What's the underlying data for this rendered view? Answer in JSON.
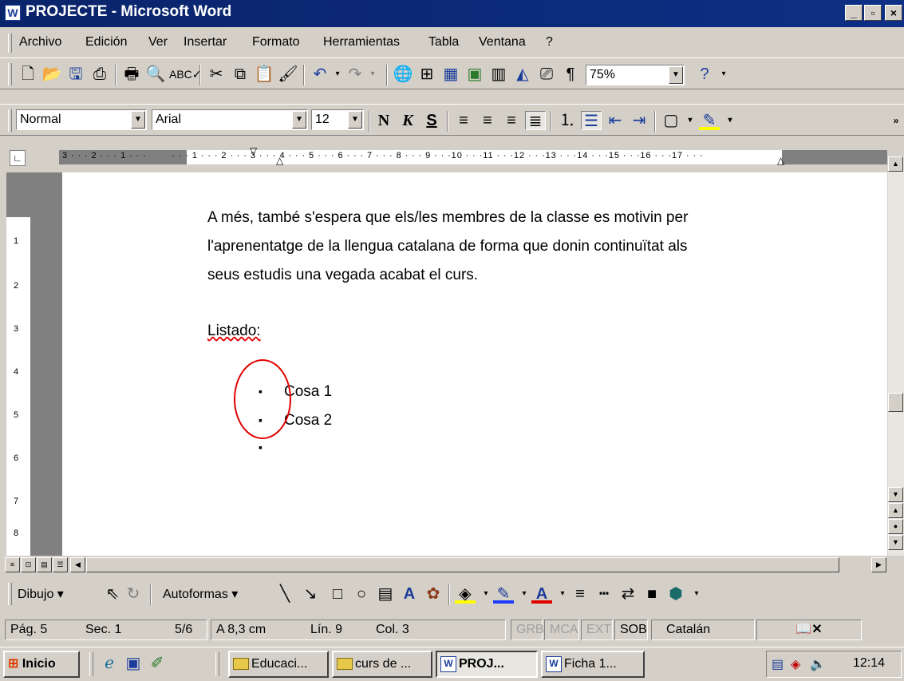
{
  "window": {
    "title": "PROJECTE - Microsoft Word",
    "app_icon": "W",
    "min": "_",
    "max": "▫",
    "close": "×"
  },
  "menu": [
    "Archivo",
    "Edición",
    "Ver",
    "Insertar",
    "Formato",
    "Herramientas",
    "Tabla",
    "Ventana",
    "?"
  ],
  "standard_toolbar": {
    "zoom": "75%"
  },
  "format_toolbar": {
    "style": "Normal",
    "font": "Arial",
    "size": "12",
    "bold": "N",
    "italic": "K",
    "underline": "S"
  },
  "ruler": {
    "labels": "3 · · · 2 · · · 1 · · ·        · · · 1 · · · 2 · · · 3 · · · 4 · · · 5 · · · 6 · · · 7 · · · 8 · · · 9 · · ·10 · · ·11 · · ·12 · · ·13 · · ·14 · · ·15 · · ·16 · · ·17 · · ·"
  },
  "vruler": [
    "1",
    "2",
    "3",
    "4",
    "5",
    "6",
    "7",
    "8"
  ],
  "document": {
    "line1": "A més, també s'espera que els/les membres de la classe es motivin per",
    "line2": "l'aprenentatge de la llengua catalana de forma que donin continuïtat  als",
    "line3": "seus estudis una vegada acabat el curs.",
    "heading": "Listado:",
    "bullets": [
      "Cosa 1",
      "Cosa 2",
      ""
    ],
    "bullet_char": "▪",
    "annotation_color": "#e00000"
  },
  "drawing": {
    "draw_label": "Dibujo",
    "autoshapes_label": "Autoformas"
  },
  "status": {
    "page": "Pág. 5",
    "section": "Sec. 1",
    "pages": "5/6",
    "position": "A 8,3 cm",
    "line": "Lín. 9",
    "col": "Col. 3",
    "grb": "GRB",
    "mca": "MCA",
    "ext": "EXT",
    "sob": "SOB",
    "language": "Catalán"
  },
  "taskbar": {
    "start": "Inicio",
    "tasks": [
      "Educaci...",
      "curs de ...",
      "PROJ...",
      "Ficha 1..."
    ],
    "clock": "12:14"
  }
}
